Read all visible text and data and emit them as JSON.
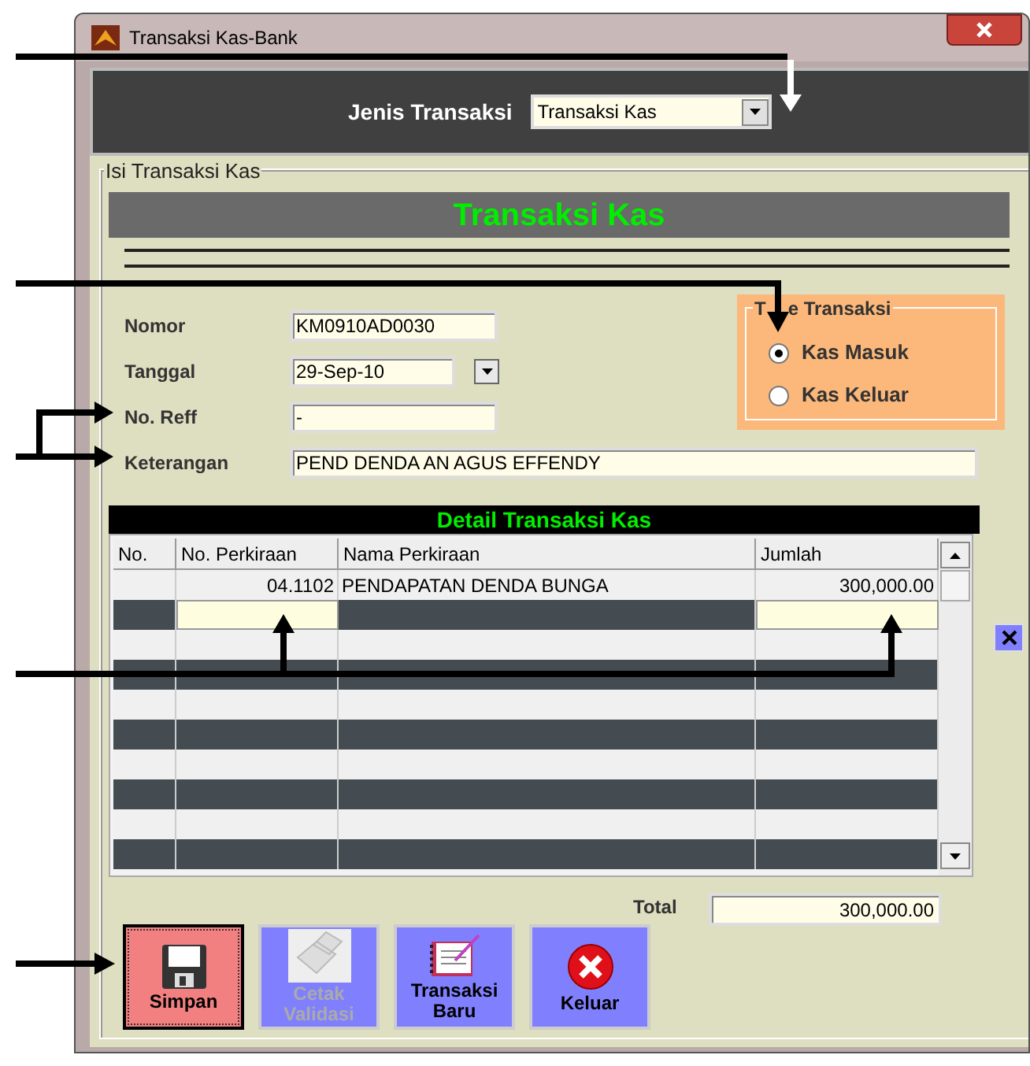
{
  "window": {
    "title": "Transaksi Kas-Bank"
  },
  "jenis_transaksi": {
    "label": "Jenis Transaksi",
    "value": "Transaksi Kas"
  },
  "group": {
    "title": "Isi Transaksi Kas"
  },
  "header": {
    "title": "Transaksi Kas"
  },
  "fields": [
    {
      "label": "Nomor",
      "value": "KM0910AD0030",
      "kind": "text"
    },
    {
      "label": "Tanggal",
      "value": "29-Sep-10",
      "kind": "date"
    },
    {
      "label": "No. Reff",
      "value": "-",
      "kind": "text"
    },
    {
      "label": "Keterangan",
      "value": "PEND DENDA AN AGUS EFFENDY",
      "kind": "wide"
    }
  ],
  "tipe_transaksi": {
    "title_parts": [
      "T",
      "e Transaksi"
    ],
    "options": [
      {
        "label": "Kas Masuk",
        "selected": true
      },
      {
        "label": "Kas Keluar",
        "selected": false
      }
    ]
  },
  "detail": {
    "title": "Detail Transaksi Kas",
    "columns": [
      "No.",
      "No. Perkiraan",
      "Nama Perkiraan",
      "Jumlah"
    ],
    "rows": [
      {
        "no_perkiraan": "04.1102",
        "nama_perkiraan": "PENDAPATAN DENDA BUNGA",
        "jumlah": "300,000.00"
      }
    ]
  },
  "total": {
    "label": "Total",
    "value": "300,000.00"
  },
  "buttons": [
    {
      "label": "Simpan",
      "kind": "save",
      "disabled": false,
      "focused": true
    },
    {
      "label": "Cetak Validasi",
      "kind": "print",
      "disabled": true,
      "focused": false
    },
    {
      "label": "Transaksi Baru",
      "kind": "new",
      "disabled": false,
      "focused": false
    },
    {
      "label": "Keluar",
      "kind": "exit",
      "disabled": false,
      "focused": false
    }
  ]
}
